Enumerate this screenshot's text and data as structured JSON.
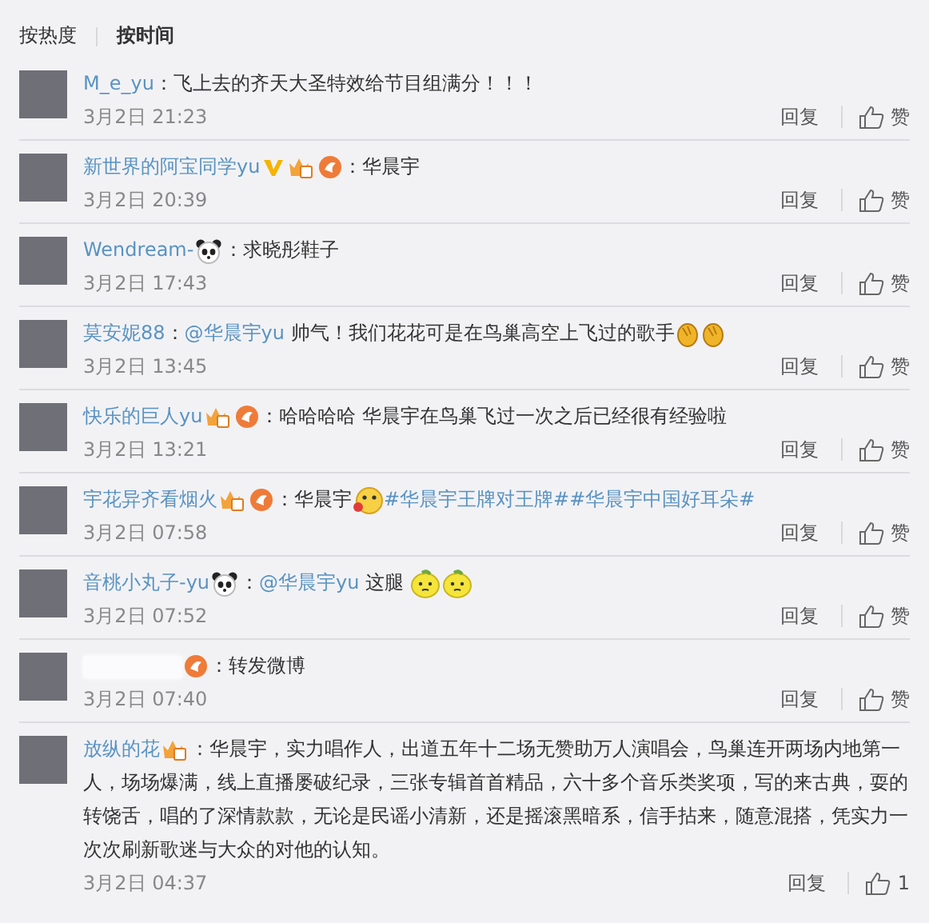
{
  "sort_tabs": [
    {
      "label": "按热度",
      "selected": false
    },
    {
      "label": "按时间",
      "selected": true
    }
  ],
  "comments": [
    {
      "name": "M_e_yu",
      "parts": [
        {
          "kind": "text",
          "text": "：飞上去的齐天大圣特效给节目组满分！！！"
        }
      ],
      "time": "3月2日 21:23",
      "reply": "回复",
      "like": "赞"
    },
    {
      "name": "新世界的阿宝同学yu",
      "badges": [
        {
          "kind": "vip"
        },
        {
          "kind": "crown"
        },
        {
          "kind": "fan"
        }
      ],
      "parts": [
        {
          "kind": "text",
          "text": "：华晨宇"
        }
      ],
      "time": "3月2日 20:39",
      "reply": "回复",
      "like": "赞"
    },
    {
      "name": "Wendream-",
      "badges": [
        {
          "kind": "panda"
        }
      ],
      "parts": [
        {
          "kind": "text",
          "text": "：求晓彤鞋子"
        }
      ],
      "time": "3月2日 17:43",
      "reply": "回复",
      "like": "赞"
    },
    {
      "name": "莫安妮88",
      "parts": [
        {
          "kind": "text",
          "text": "："
        },
        {
          "kind": "link",
          "text": "@华晨宇yu"
        },
        {
          "kind": "text",
          "text": " 帅气！我们花花可是在鸟巢高空上飞过的歌手"
        },
        {
          "kind": "clap"
        },
        {
          "kind": "clap"
        }
      ],
      "time": "3月2日 13:45",
      "reply": "回复",
      "like": "赞"
    },
    {
      "name": "快乐的巨人yu",
      "badges": [
        {
          "kind": "crown"
        },
        {
          "kind": "fan"
        }
      ],
      "parts": [
        {
          "kind": "text",
          "text": "：哈哈哈哈 华晨宇在鸟巢飞过一次之后已经很有经验啦"
        }
      ],
      "time": "3月2日 13:21",
      "reply": "回复",
      "like": "赞"
    },
    {
      "name": "宇花异齐看烟火",
      "badges": [
        {
          "kind": "crown"
        },
        {
          "kind": "fan"
        }
      ],
      "parts": [
        {
          "kind": "text",
          "text": "：华晨宇"
        },
        {
          "kind": "kiss"
        },
        {
          "kind": "link",
          "text": "#华晨宇王牌对王牌#"
        },
        {
          "kind": "link",
          "text": "#华晨宇中国好耳朵#"
        }
      ],
      "time": "3月2日 07:58",
      "reply": "回复",
      "like": "赞"
    },
    {
      "name": "音桃小丸子-yu",
      "badges": [
        {
          "kind": "panda"
        }
      ],
      "parts": [
        {
          "kind": "text",
          "text": "："
        },
        {
          "kind": "link",
          "text": "@华晨宇yu"
        },
        {
          "kind": "text",
          "text": " 这腿 "
        },
        {
          "kind": "lemon"
        },
        {
          "kind": "lemon"
        }
      ],
      "time": "3月2日 07:52",
      "reply": "回复",
      "like": "赞"
    },
    {
      "badges": [
        {
          "kind": "fan"
        }
      ],
      "parts": [
        {
          "kind": "text",
          "text": "：转发微博"
        }
      ],
      "time": "3月2日 07:40",
      "reply": "回复",
      "like": "赞"
    },
    {
      "name": "放纵的花",
      "badges": [
        {
          "kind": "crown"
        }
      ],
      "parts": [
        {
          "kind": "text",
          "text": "：华晨宇，实力唱作人，出道五年十二场无赞助万人演唱会，鸟巢连开两场内地第一人，场场爆满，线上直播屡破纪录，三张专辑首首精品，六十多个音乐类奖项，写的来古典，耍的转饶舌，唱的了深情款款，无论是民谣小清新，还是摇滚黑暗系，信手拈来，随意混搭，凭实力一次次刷新歌迷与大众的对他的认知。"
        }
      ],
      "time": "3月2日 04:37",
      "reply": "回复",
      "like": "1"
    }
  ]
}
